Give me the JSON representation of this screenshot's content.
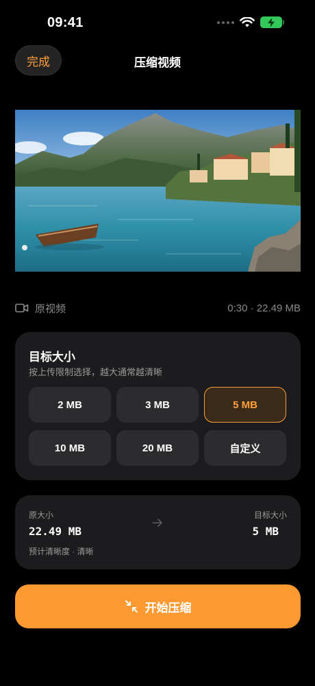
{
  "status_bar": {
    "time": "09:41",
    "icons": [
      "signal-dots-icon",
      "wifi-icon",
      "battery-charging-icon"
    ],
    "battery_color": "#34c759"
  },
  "nav": {
    "done_label": "完成",
    "title": "压缩视频"
  },
  "preview": {
    "description_icon": "video-thumbnail"
  },
  "video_meta": {
    "label": "原视频",
    "duration_size": "0:30 · 22.49 MB",
    "icon": "video-camera-icon"
  },
  "target": {
    "title": "目标大小",
    "hint": "按上传限制选择，越大通常越清晰",
    "options": [
      {
        "label": "2 MB",
        "selected": false
      },
      {
        "label": "3 MB",
        "selected": false
      },
      {
        "label": "5 MB",
        "selected": true
      },
      {
        "label": "10 MB",
        "selected": false
      },
      {
        "label": "20 MB",
        "selected": false
      },
      {
        "label": "自定义",
        "selected": false
      }
    ]
  },
  "summary": {
    "original_label": "原大小",
    "original_value": "22.49 MB",
    "target_label": "目标大小",
    "target_value": "5 MB",
    "quality": "预计清晰度 · 清晰",
    "arrow_icon": "arrow-right-icon"
  },
  "start_button": {
    "label": "开始压缩",
    "icon": "compress-arrows-icon"
  },
  "colors": {
    "accent": "#ff9f3a",
    "button": "#ff9a32",
    "card": "#1c1c1e",
    "option": "#2c2c2e"
  }
}
